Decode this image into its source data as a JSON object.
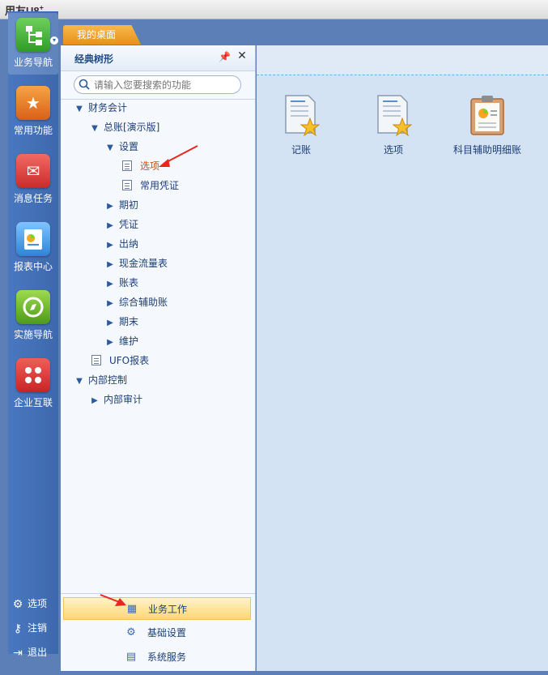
{
  "app": {
    "logo": "用友U8",
    "logo_sup": "+"
  },
  "tab": {
    "label": "我的桌面"
  },
  "rail": {
    "items": [
      {
        "label": "业务导航",
        "icon": "tree-nav-icon"
      },
      {
        "label": "常用功能",
        "icon": "star-icon"
      },
      {
        "label": "消息任务",
        "icon": "mail-icon"
      },
      {
        "label": "报表中心",
        "icon": "report-icon"
      },
      {
        "label": "实施导航",
        "icon": "compass-icon"
      },
      {
        "label": "企业互联",
        "icon": "connect-icon"
      }
    ],
    "bottom": [
      {
        "label": "选项",
        "icon": "gear-icon"
      },
      {
        "label": "注销",
        "icon": "key-icon"
      },
      {
        "label": "退出",
        "icon": "exit-icon"
      }
    ]
  },
  "tree_panel": {
    "title": "经典树形",
    "search_placeholder": "请输入您要搜索的功能",
    "nodes": [
      {
        "label": "财务会计"
      },
      {
        "label": "总账[演示版]"
      },
      {
        "label": "设置"
      },
      {
        "label": "选项"
      },
      {
        "label": "常用凭证"
      },
      {
        "label": "期初"
      },
      {
        "label": "凭证"
      },
      {
        "label": "出纳"
      },
      {
        "label": "现金流量表"
      },
      {
        "label": "账表"
      },
      {
        "label": "综合辅助账"
      },
      {
        "label": "期末"
      },
      {
        "label": "维护"
      },
      {
        "label": "UFO报表"
      },
      {
        "label": "内部控制"
      },
      {
        "label": "内部审计"
      }
    ],
    "bottom": [
      {
        "label": "业务工作"
      },
      {
        "label": "基础设置"
      },
      {
        "label": "系统服务"
      }
    ]
  },
  "main": {
    "functions": [
      {
        "label": "记账"
      },
      {
        "label": "选项"
      },
      {
        "label": "科目辅助明细账"
      }
    ]
  },
  "colors": {
    "accent_orange": "#e8901b",
    "selected_text": "#c0501a",
    "arrow_red": "#e8261f"
  }
}
